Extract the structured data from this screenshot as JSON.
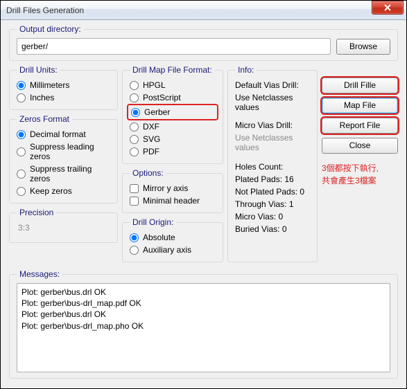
{
  "window": {
    "title": "Drill Files Generation"
  },
  "output": {
    "legend": "Output directory:",
    "value": "gerber/",
    "browse": "Browse"
  },
  "drill_units": {
    "legend": "Drill Units:",
    "options": [
      "Millimeters",
      "Inches"
    ],
    "selected": 0
  },
  "zeros_format": {
    "legend": "Zeros Format",
    "options": [
      "Decimal format",
      "Suppress leading zeros",
      "Suppress trailing zeros",
      "Keep zeros"
    ],
    "selected": 0
  },
  "precision": {
    "legend": "Precision",
    "value": "3:3"
  },
  "drill_map": {
    "legend": "Drill Map File Format:",
    "options": [
      "HPGL",
      "PostScript",
      "Gerber",
      "DXF",
      "SVG",
      "PDF"
    ],
    "selected": 2
  },
  "options": {
    "legend": "Options:",
    "items": [
      "Mirror y axis",
      "Minimal header"
    ]
  },
  "drill_origin": {
    "legend": "Drill Origin:",
    "options": [
      "Absolute",
      "Auxiliary axis"
    ],
    "selected": 0
  },
  "info": {
    "legend": "Info:",
    "default_vias_label": "Default Vias Drill:",
    "default_vias_value": "Use Netclasses values",
    "micro_vias_label": "Micro Vias Drill:",
    "micro_vias_value": "Use Netclasses values",
    "holes_count_label": "Holes Count:",
    "holes": {
      "plated": "Plated Pads: 16",
      "not_plated": "Not Plated Pads: 0",
      "through": "Through Vias: 1",
      "micro": "Micro Vias: 0",
      "buried": "Buried Vias: 0"
    }
  },
  "buttons": {
    "drill_file": "Drill Fille",
    "map_file": "Map File",
    "report_file": "Report File",
    "close": "Close"
  },
  "annotation": {
    "line1": "3個都按下執行,",
    "line2": "共會產生3檔案"
  },
  "messages": {
    "legend": "Messages:",
    "lines": [
      "Plot: gerber\\bus.drl OK",
      "Plot: gerber\\bus-drl_map.pdf OK",
      "Plot: gerber\\bus.drl OK",
      "Plot: gerber\\bus-drl_map.pho OK"
    ]
  }
}
